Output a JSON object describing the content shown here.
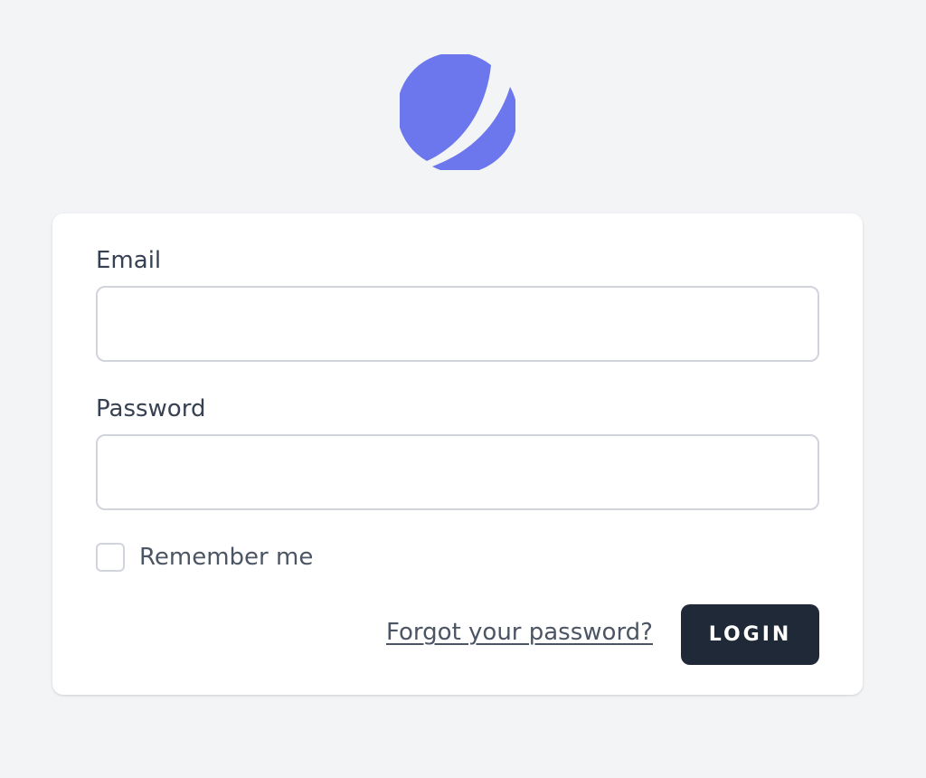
{
  "logo": {
    "icon": "planet-logo-icon",
    "color": "#6c76ed"
  },
  "form": {
    "email_label": "Email",
    "email_value": "",
    "password_label": "Password",
    "password_value": "",
    "remember_label": "Remember me",
    "remember_checked": false,
    "forgot_link": "Forgot your password?",
    "login_button": "LOGIN"
  },
  "colors": {
    "background": "#f3f4f6",
    "card": "#ffffff",
    "button": "#1f2937",
    "text": "#374151",
    "border": "#d1d5db"
  }
}
